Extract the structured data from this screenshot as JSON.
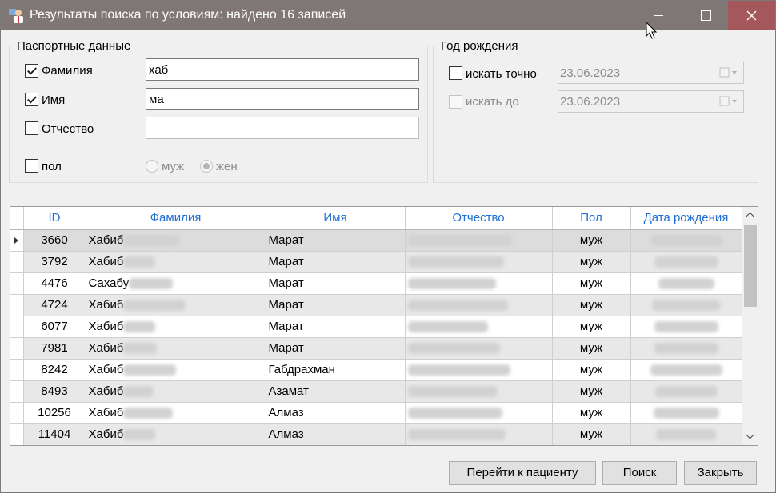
{
  "window": {
    "title": "Результаты поиска по условиям: найдено 16 записей",
    "icon": "patient-app-icon"
  },
  "passport": {
    "legend": "Паспортные данные",
    "surname": {
      "label": "Фамилия",
      "checked": true,
      "value": "хаб"
    },
    "name": {
      "label": "Имя",
      "checked": true,
      "value": "ма"
    },
    "patronymic": {
      "label": "Отчество",
      "checked": false,
      "value": ""
    },
    "sex": {
      "label": "пол",
      "checked": false,
      "options": [
        "муж",
        "жен"
      ],
      "selected": "жен"
    }
  },
  "birth": {
    "legend": "Год рождения",
    "exact": {
      "label": "искать точно",
      "checked": false,
      "value": "23.06.2023"
    },
    "until": {
      "label": "искать до",
      "checked": false,
      "value": "23.06.2023"
    }
  },
  "grid": {
    "columns": [
      "ID",
      "Фамилия",
      "Имя",
      "Отчество",
      "Пол",
      "Дата рождения"
    ],
    "rows": [
      {
        "id": "3660",
        "surname": "Хабиб",
        "name": "Марат",
        "sex": "муж"
      },
      {
        "id": "3792",
        "surname": "Хабиб",
        "name": "Марат",
        "sex": "муж"
      },
      {
        "id": "4476",
        "surname": "Сахабу",
        "name": "Марат",
        "sex": "муж"
      },
      {
        "id": "4724",
        "surname": "Хабиб",
        "name": "Марат",
        "sex": "муж"
      },
      {
        "id": "6077",
        "surname": "Хабиб",
        "name": "Марат",
        "sex": "муж"
      },
      {
        "id": "7981",
        "surname": "Хабиб",
        "name": "Марат",
        "sex": "муж"
      },
      {
        "id": "8242",
        "surname": "Хабиб",
        "name": "Габдрахман",
        "sex": "муж"
      },
      {
        "id": "8493",
        "surname": "Хабиб",
        "name": "Азамат",
        "sex": "муж"
      },
      {
        "id": "10256",
        "surname": "Хабиб",
        "name": "Алмаз",
        "sex": "муж"
      },
      {
        "id": "11404",
        "surname": "Хабиб",
        "name": "Алмаз",
        "sex": "муж"
      }
    ]
  },
  "buttons": {
    "goto_patient": "Перейти к пациенту",
    "search": "Поиск",
    "close": "Закрыть"
  },
  "colors": {
    "titlebar": "#7f7676",
    "close_button": "#a4585b",
    "header_text": "#1f6fd6"
  }
}
